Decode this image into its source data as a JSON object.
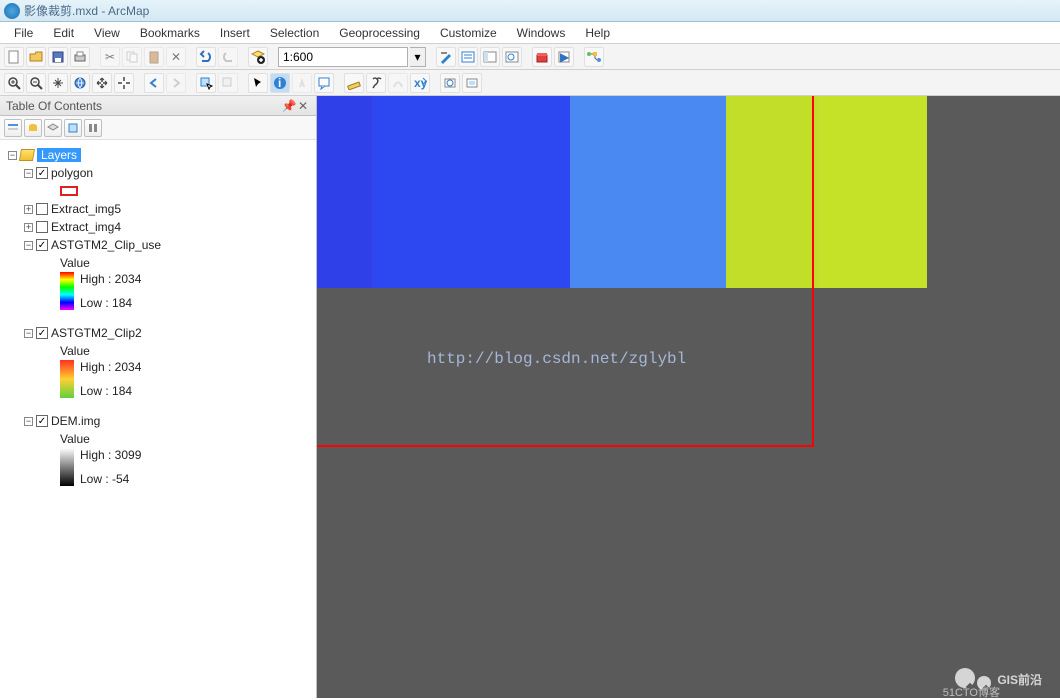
{
  "title": "影像裁剪.mxd - ArcMap",
  "menu": [
    "File",
    "Edit",
    "View",
    "Bookmarks",
    "Insert",
    "Selection",
    "Geoprocessing",
    "Customize",
    "Windows",
    "Help"
  ],
  "scale": "1:600",
  "toc": {
    "title": "Table Of Contents",
    "root": "Layers",
    "items": [
      {
        "name": "polygon",
        "checked": true,
        "symbol": "rect"
      },
      {
        "name": "Extract_img5",
        "checked": false
      },
      {
        "name": "Extract_img4",
        "checked": false
      },
      {
        "name": "ASTGTM2_Clip_use",
        "checked": true,
        "valueLabel": "Value",
        "high": "High : 2034",
        "low": "Low : 184",
        "ramp": "rainbow"
      },
      {
        "name": "ASTGTM2_Clip2",
        "checked": true,
        "valueLabel": "Value",
        "high": "High : 2034",
        "low": "Low : 184",
        "ramp": "redgreen"
      },
      {
        "name": "DEM.img",
        "checked": true,
        "valueLabel": "Value",
        "high": "High : 3099",
        "low": "Low : -54",
        "ramp": "gray"
      }
    ]
  },
  "watermark_url": "http://blog.csdn.net/zglybl",
  "wm_text": "GIS前沿",
  "wm_small": "51CTO博客"
}
